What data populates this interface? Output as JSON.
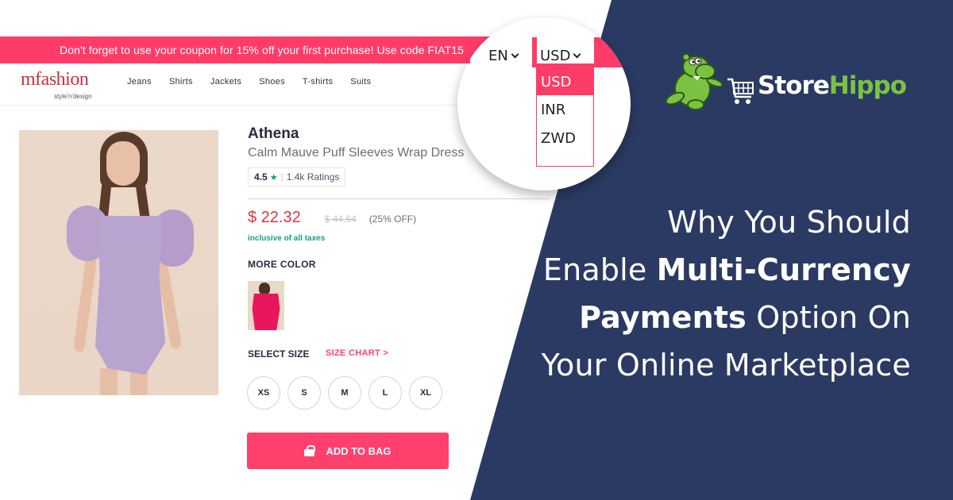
{
  "promo": {
    "text": "Don't forget to use your coupon for 15% off your first purchase! Use code FIAT15"
  },
  "header": {
    "logo_main": "mfashion",
    "logo_tagline": "style'n'design",
    "nav": [
      "Jeans",
      "Shirts",
      "Jackets",
      "Shoes",
      "T-shirts",
      "Suits"
    ]
  },
  "product": {
    "image_icon": "product-photo-lavender-wrap-dress",
    "brand": "Athena",
    "name": "Calm Mauve Puff Sleeves Wrap Dress",
    "rating": {
      "value": "4.5",
      "star": "★",
      "separator": "|",
      "count": "1.4k Ratings"
    },
    "price": {
      "current": "$ 22.32",
      "original": "$ 44.64",
      "discount": "(25% OFF)"
    },
    "tax_note": "inclusive of all taxes",
    "more_color_label": "MORE COLOR",
    "colors": [
      {
        "name": "Pink",
        "hex": "#e8175d"
      }
    ],
    "size_label": "SELECT SIZE",
    "size_chart_label": "SIZE CHART >",
    "sizes": [
      "XS",
      "S",
      "M",
      "L",
      "XL"
    ],
    "add_to_bag_label": "ADD TO BAG"
  },
  "magnifier": {
    "language": "EN",
    "currency": "USD",
    "currency_options": [
      "USD",
      "INR",
      "ZWD"
    ],
    "selected_currency": "USD"
  },
  "brand_logo": {
    "word_white": "Store",
    "word_green": "Hippo"
  },
  "headline": {
    "line1": "Why You Should",
    "line2_light": "Enable ",
    "line2_bold": "Multi-Currency",
    "line3_bold": "Payments",
    "line3_light": " Option On",
    "line4": "Your Online Marketplace"
  },
  "colors": {
    "accent_pink": "#ff3b68",
    "navy": "#2b3a63",
    "price_red": "#e0323e",
    "tax_green": "#14a37f",
    "rating_star": "#14958f",
    "hippo_green": "#7cc242"
  }
}
